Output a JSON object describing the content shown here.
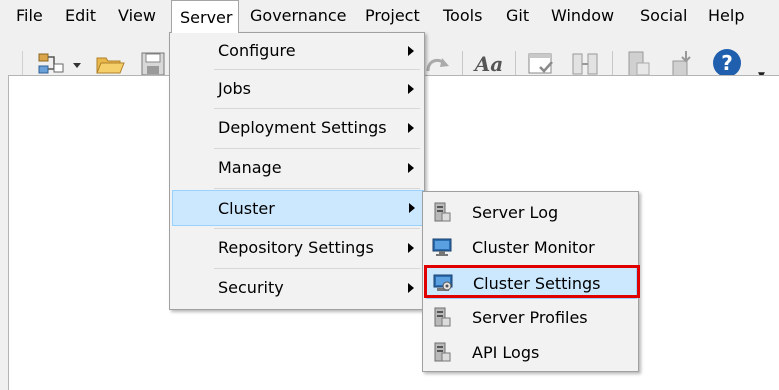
{
  "menubar": {
    "items": [
      {
        "label": "File"
      },
      {
        "label": "Edit"
      },
      {
        "label": "View"
      },
      {
        "label": "Server"
      },
      {
        "label": "Governance"
      },
      {
        "label": "Project"
      },
      {
        "label": "Tools"
      },
      {
        "label": "Git"
      },
      {
        "label": "Window"
      },
      {
        "label": "Social"
      },
      {
        "label": "Help"
      }
    ]
  },
  "toolbar": {
    "font_button_label": "Aa",
    "help_glyph": "?",
    "icons": [
      "new-item-icon",
      "dropdown-arrow-icon",
      "open-folder-icon",
      "save-icon",
      "redo-icon",
      "font-icon",
      "window-check-icon",
      "compare-icon",
      "database-icon",
      "deploy-icon",
      "help-icon"
    ]
  },
  "server_menu": {
    "items": [
      {
        "label": "Configure",
        "has_submenu": true
      },
      {
        "label": "Jobs",
        "has_submenu": true
      },
      {
        "label": "Deployment Settings",
        "has_submenu": true
      },
      {
        "label": "Manage",
        "has_submenu": true
      },
      {
        "label": "Cluster",
        "has_submenu": true,
        "highlighted": true
      },
      {
        "label": "Repository Settings",
        "has_submenu": true
      },
      {
        "label": "Security",
        "has_submenu": true
      }
    ]
  },
  "cluster_submenu": {
    "items": [
      {
        "label": "Server Log",
        "icon": "server-log-icon"
      },
      {
        "label": "Cluster Monitor",
        "icon": "monitor-icon"
      },
      {
        "label": "Cluster Settings",
        "icon": "cluster-settings-icon",
        "highlighted": true
      },
      {
        "label": "Server Profiles",
        "icon": "server-profiles-icon"
      },
      {
        "label": "API Logs",
        "icon": "api-logs-icon"
      }
    ]
  },
  "colors": {
    "highlight": "#cce8ff",
    "highlight_border": "#99d1ff",
    "annotation": "#e00000"
  }
}
